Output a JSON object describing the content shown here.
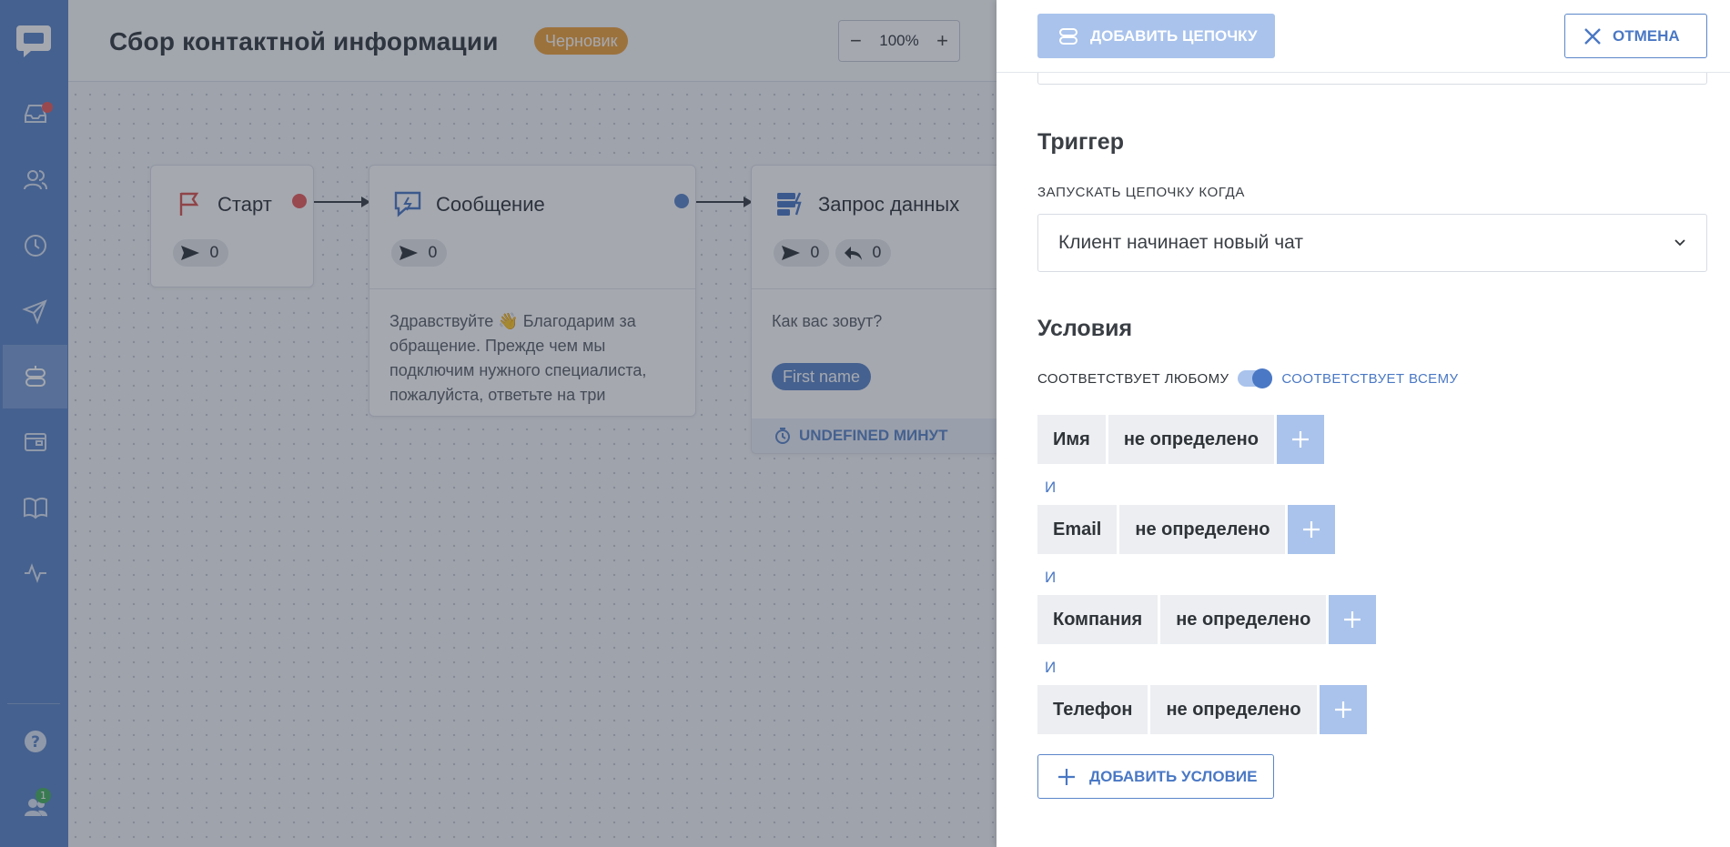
{
  "header": {
    "title": "Сбор контактной информации",
    "status_badge": "Черновик",
    "zoom_level": "100%",
    "zoom_minus": "−",
    "zoom_plus": "+"
  },
  "sidebar": {
    "items": [
      {
        "icon": "inbox-icon"
      },
      {
        "icon": "users-icon"
      },
      {
        "icon": "clock-icon"
      },
      {
        "icon": "send-icon"
      },
      {
        "icon": "bot-icon",
        "active": true
      },
      {
        "icon": "wallet-icon"
      },
      {
        "icon": "book-icon"
      },
      {
        "icon": "activity-icon"
      }
    ],
    "help_icon": "question-icon",
    "team_badge": "1"
  },
  "flow": {
    "nodes": [
      {
        "title": "Старт",
        "sent": "0",
        "icon": "flag-icon"
      },
      {
        "title": "Сообщение",
        "sent": "0",
        "icon": "message-bolt-icon",
        "body_lines": [
          "Здравствуйте 👋 Благодарим за",
          "обращение. Прежде чем мы",
          "подключим нужного специалиста,",
          "пожалуйста, ответьте на три"
        ]
      },
      {
        "title": "Запрос данных",
        "sent": "0",
        "replied": "0",
        "icon": "data-request-icon",
        "body": "Как вас зовут?",
        "chip": "First name",
        "timer": "UNDEFINED МИНУТ"
      }
    ]
  },
  "panel": {
    "add_chain_label": "ДОБАВИТЬ ЦЕПОЧКУ",
    "cancel_label": "ОТМЕНА",
    "trigger_title": "Триггер",
    "trigger_label": "ЗАПУСКАТЬ ЦЕПОЧКУ КОГДА",
    "trigger_value": "Клиент начинает новый чат",
    "conditions_title": "Условия",
    "match_any": "СООТВЕТСТВУЕТ ЛЮБОМУ",
    "match_all": "СООТВЕТСТВУЕТ ВСЕМУ",
    "match_all_selected": true,
    "and_label": "И",
    "conditions": [
      {
        "field": "Имя",
        "operator": "не определено"
      },
      {
        "field": "Email",
        "operator": "не определено"
      },
      {
        "field": "Компания",
        "operator": "не определено"
      },
      {
        "field": "Телефон",
        "operator": "не определено"
      }
    ],
    "add_condition_label": "ДОБАВИТЬ УСЛОВИЕ"
  },
  "colors": {
    "sidebar": "#5b86c9",
    "accent": "#4a78c4",
    "draft_badge": "#f0a33a",
    "start_port": "#e85b5b",
    "message_port": "#5b86c9"
  }
}
